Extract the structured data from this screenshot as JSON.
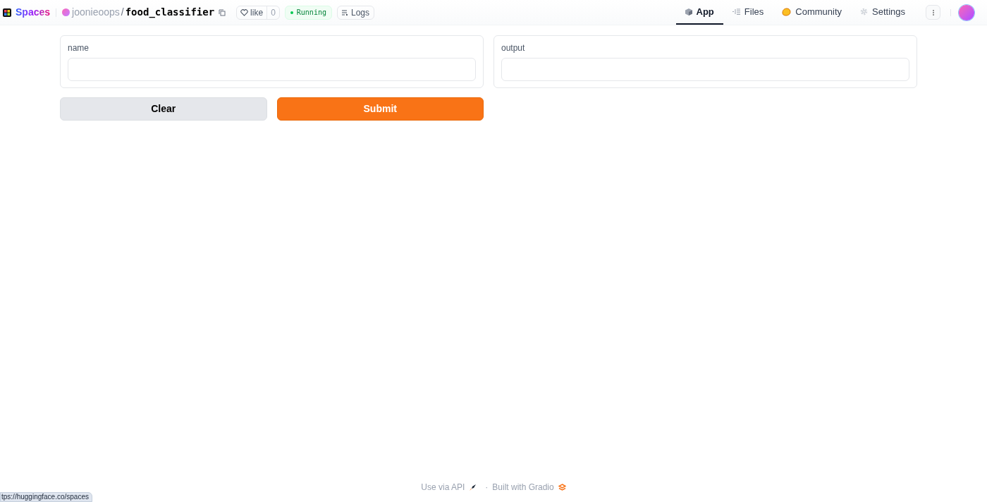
{
  "header": {
    "brand": "Spaces",
    "owner": "joonieoops",
    "separator": "/",
    "repo": "food_classifier",
    "like": {
      "label": "like",
      "count": "0"
    },
    "status": "Running",
    "logs": "Logs"
  },
  "tabs": [
    {
      "label": "App",
      "kind": "app",
      "selected": true
    },
    {
      "label": "Files",
      "kind": "files",
      "selected": false
    },
    {
      "label": "Community",
      "kind": "community",
      "selected": false
    },
    {
      "label": "Settings",
      "kind": "settings",
      "selected": false
    }
  ],
  "inputs": [
    {
      "label": "name"
    },
    {
      "label": "output"
    }
  ],
  "buttons": [
    {
      "label": "Clear",
      "kind": "secondary"
    },
    {
      "label": "Submit",
      "kind": "primary"
    }
  ],
  "footer": {
    "api": "Use via API",
    "dot": "·",
    "built": "Built with Gradio"
  },
  "status_bar": "tps://huggingface.co/spaces"
}
